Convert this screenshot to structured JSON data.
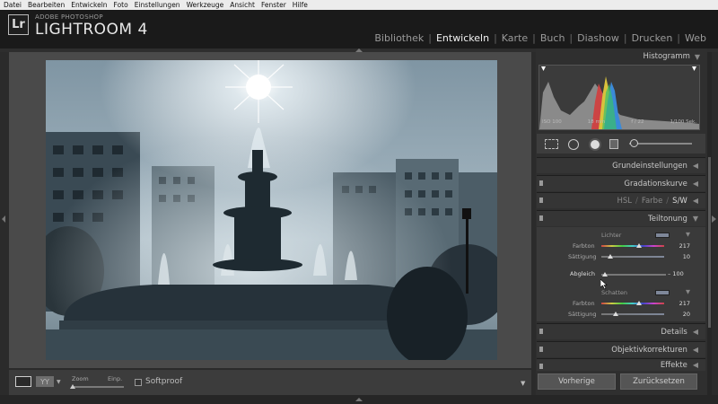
{
  "menu": [
    "Datei",
    "Bearbeiten",
    "Entwickeln",
    "Foto",
    "Einstellungen",
    "Werkzeuge",
    "Ansicht",
    "Fenster",
    "Hilfe"
  ],
  "brand": {
    "logo": "Lr",
    "top": "ADOBE PHOTOSHOP",
    "main": "LIGHTROOM 4"
  },
  "modules": [
    "Bibliothek",
    "Entwickeln",
    "Karte",
    "Buch",
    "Diashow",
    "Drucken",
    "Web"
  ],
  "active_module": "Entwickeln",
  "histogram": {
    "title": "Histogramm",
    "iso": "ISO 100",
    "focal": "18 mm",
    "aperture": "f / 22",
    "shutter": "1/100 Sek."
  },
  "panels": {
    "grund": "Grundeinstellungen",
    "gradation": "Gradationskurve",
    "hsl": "HSL",
    "farbe": "Farbe",
    "sw": "S/W",
    "teiltonung": "Teiltonung",
    "details": "Details",
    "objektiv": "Objektivkorrekturen",
    "effekte": "Effekte"
  },
  "split": {
    "lichter": "Lichter",
    "schatten": "Schatten",
    "farbton_label": "Farbton",
    "saettigung_label": "Sättigung",
    "abgleich_label": "Abgleich",
    "lichter_farbton": "217",
    "lichter_saettigung": "10",
    "abgleich": "– 100",
    "schatten_farbton": "217",
    "schatten_saettigung": "20"
  },
  "toolbar": {
    "zoom": "Zoom",
    "zoom_val": "Einp.",
    "softproof": "Softproof"
  },
  "buttons": {
    "prev": "Vorherige",
    "reset": "Zurücksetzen"
  },
  "colors": {
    "accent": "#e8e8e8",
    "panel": "#353535",
    "swatch": "#7e8799"
  }
}
